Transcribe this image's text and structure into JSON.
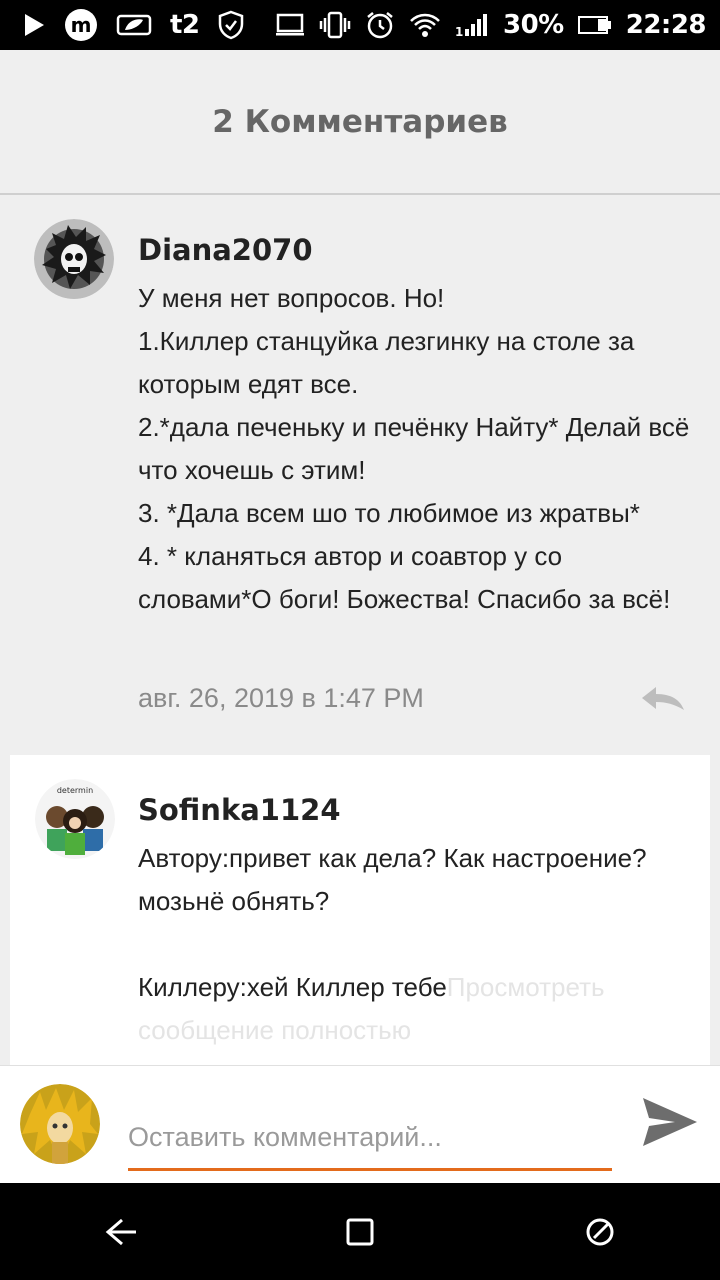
{
  "status_bar": {
    "battery_percent": "30%",
    "time": "22:28",
    "carrier": "t2",
    "icons": [
      "play-icon",
      "m-app-icon",
      "leaf-app-icon",
      "t2-carrier-icon",
      "shield-check-icon",
      "cast-icon",
      "vibrate-icon",
      "alarm-icon",
      "wifi-icon",
      "signal-icon",
      "battery-icon"
    ]
  },
  "header": {
    "title": "2 Комментариев"
  },
  "comments": [
    {
      "username": "Diana2070",
      "text": "У меня нет вопросов. Но!\n1.Киллер станцуйка лезгинку на столе за которым едят все.\n2.*дала печеньку и печёнку Найту* Делай всё что хочешь с этим!\n3. *Дала всем шо то любимое из жратвы*\n4. * кланяться автор и соавтор у со словами*О боги! Божества! Спасибо за всё!",
      "timestamp": "авг. 26, 2019 в 1:47 PM",
      "avatar_icon": "skull-splatter-avatar"
    },
    {
      "username": "Sofinka1124",
      "text": "Автору:привет как дела? Как настроение?мозьнё обнять?\n\nКиллеру:хей Киллер тебе",
      "more_link": "Просмотреть сообщение полностью",
      "avatar_icon": "characters-avatar",
      "avatar_caption": "determin"
    }
  ],
  "composer": {
    "placeholder": "Оставить комментарий...",
    "accent_color": "#e36b1c"
  },
  "nav_bar": {
    "icons": [
      "back-icon",
      "home-icon",
      "recents-icon"
    ]
  }
}
